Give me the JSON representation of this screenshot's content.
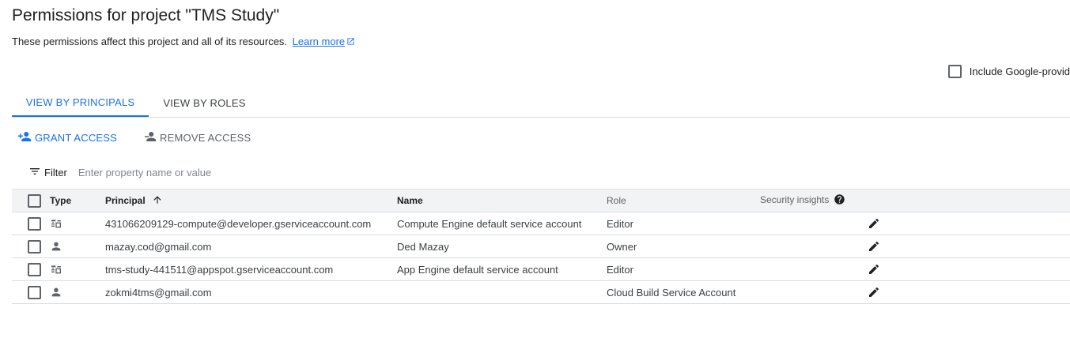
{
  "header": {
    "title": "Permissions for project \"TMS Study\"",
    "description": "These permissions affect this project and all of its resources.",
    "learn_more": "Learn more"
  },
  "include_google": {
    "label": "Include Google-provid",
    "checked": false
  },
  "tabs": [
    {
      "label": "VIEW BY PRINCIPALS",
      "active": true
    },
    {
      "label": "VIEW BY ROLES",
      "active": false
    }
  ],
  "actions": {
    "grant": "GRANT ACCESS",
    "remove": "REMOVE ACCESS"
  },
  "filter": {
    "label": "Filter",
    "placeholder": "Enter property name or value"
  },
  "table": {
    "columns": {
      "type": "Type",
      "principal": "Principal",
      "name": "Name",
      "role": "Role",
      "security": "Security insights"
    },
    "rows": [
      {
        "type_icon": "service-account-icon",
        "principal": "431066209129-compute@developer.gserviceaccount.com",
        "name": "Compute Engine default service account",
        "role": "Editor"
      },
      {
        "type_icon": "person-icon",
        "principal": "mazay.cod@gmail.com",
        "name": "Ded Mazay",
        "role": "Owner"
      },
      {
        "type_icon": "service-account-icon",
        "principal": "tms-study-441511@appspot.gserviceaccount.com",
        "name": "App Engine default service account",
        "role": "Editor"
      },
      {
        "type_icon": "person-icon",
        "principal": "zokmi4tms@gmail.com",
        "name": "",
        "role": "Cloud Build Service Account"
      }
    ]
  },
  "colors": {
    "accent": "#1a73e8",
    "text": "#202124",
    "muted": "#5f6368",
    "divider": "#dadce0"
  }
}
